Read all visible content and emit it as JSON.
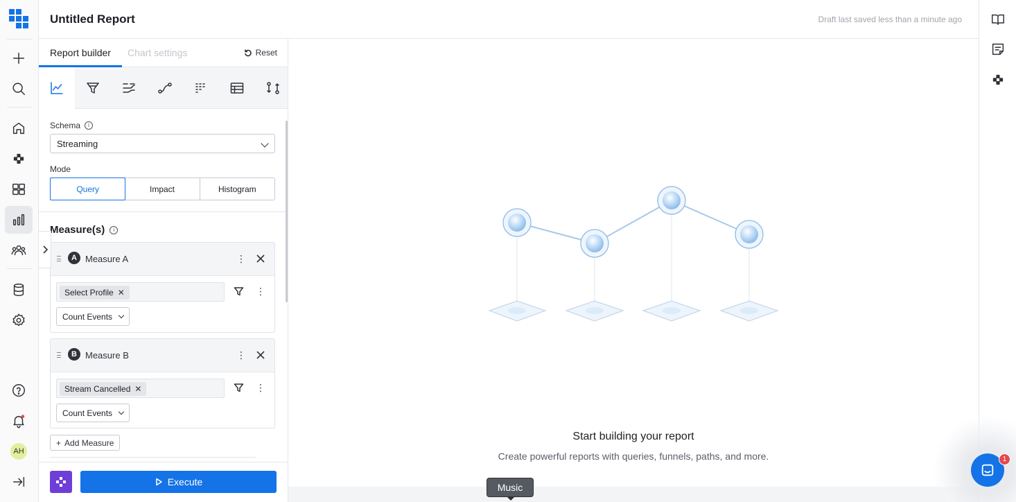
{
  "header": {
    "title": "Untitled Report",
    "draft_status": "Draft last saved less than a minute ago"
  },
  "nav": {
    "items": [
      "create-icon",
      "search-icon",
      "home-icon",
      "shortcuts-icon",
      "dashboards-icon",
      "reports-icon",
      "audiences-icon",
      "data-icon",
      "settings-icon",
      "help-icon",
      "notifications-icon"
    ],
    "active": "reports-icon",
    "avatar_initials": "AH"
  },
  "right_rail": {
    "items": [
      "book-icon",
      "notes-icon",
      "shortcuts-icon"
    ]
  },
  "builder": {
    "tabs": [
      "Report builder",
      "Chart settings"
    ],
    "active_tab": "Report builder",
    "reset_label": "Reset",
    "viz_types": [
      "line-chart-icon",
      "funnel-icon",
      "flow-icon",
      "path-icon",
      "heatmap-icon",
      "table-icon",
      "compare-icon"
    ],
    "active_viz": "line-chart-icon",
    "schema_label": "Schema",
    "schema_value": "Streaming",
    "mode_label": "Mode",
    "modes": [
      "Query",
      "Impact",
      "Histogram"
    ],
    "active_mode": "Query",
    "measures_label": "Measure(s)",
    "measures": [
      {
        "letter": "A",
        "name": "Measure A",
        "event": "Select Profile",
        "aggregation": "Count Events"
      },
      {
        "letter": "B",
        "name": "Measure B",
        "event": "Stream Cancelled",
        "aggregation": "Count Events"
      }
    ],
    "add_measure_label": "Add Measure",
    "execute_label": "Execute"
  },
  "main": {
    "empty_title": "Start building your report",
    "empty_subtitle": "Create powerful reports with queries, funnels, paths, and more."
  },
  "tooltip": {
    "text": "Music"
  },
  "chat": {
    "unread": "1"
  },
  "colors": {
    "accent": "#1473e6",
    "brand_purple": "#6e3fd8",
    "badge_red": "#e5484d"
  }
}
